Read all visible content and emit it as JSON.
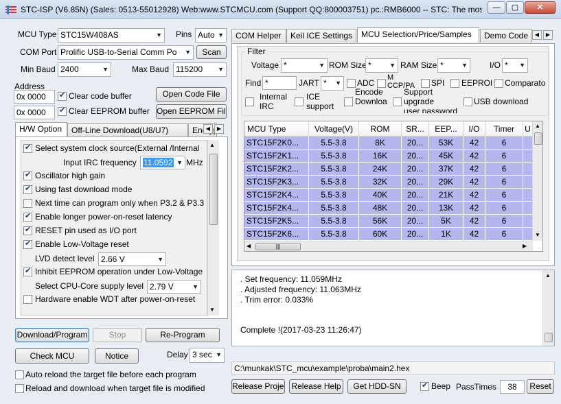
{
  "window": {
    "title": "STC-ISP (V6.85N) (Sales: 0513-55012928) Web:www.STCMCU.com  (Support QQ:800003751)  pc.:RMB6000 -- STC: The most p",
    "minimize_label": "—",
    "maximize_label": "▢",
    "close_label": "✕"
  },
  "left": {
    "mcu_type_label": "MCU Type",
    "mcu_type_value": "STC15W408AS",
    "pins_label": "Pins",
    "pins_value": "Auto",
    "com_port_label": "COM Port",
    "com_port_value": "Prolific USB-to-Serial Comm Po",
    "scan_label": "Scan",
    "min_baud_label": "Min Baud",
    "min_baud_value": "2400",
    "max_baud_label": "Max Baud",
    "max_baud_value": "115200",
    "address_label": "Address",
    "address1_value": "0x 0000",
    "address2_value": "0x 0000",
    "clear_code_label": "Clear code buffer",
    "clear_eeprom_label": "Clear EEPROM buffer",
    "open_code_label": "Open Code File",
    "open_eeprom_label": "Open EEPROM File"
  },
  "options_tabs": [
    "H/W Option",
    "Off-Line Download(U8/U7)",
    "Encryp"
  ],
  "hw_options": {
    "items": [
      {
        "label": "Select system clock source(External /Internal",
        "checked": true
      },
      {
        "label": "Oscillator high gain",
        "checked": true
      },
      {
        "label": "Using fast download mode",
        "checked": true
      },
      {
        "label": "Next time can program only when P3.2 & P3.3",
        "checked": false
      },
      {
        "label": "Enable longer power-on-reset latency",
        "checked": true
      },
      {
        "label": "RESET pin used as I/O port",
        "checked": true
      },
      {
        "label": "Enable Low-Voltage reset",
        "checked": true
      },
      {
        "label": "Inhibit EEPROM operation under Low-Voltage",
        "checked": true
      },
      {
        "label": "Hardware enable WDT after power-on-reset",
        "checked": false
      }
    ],
    "irc_label": "Input IRC frequency",
    "irc_value": "11.0592",
    "irc_unit": "MHz",
    "lvd_label": "LVD detect level",
    "lvd_value": "2.66 V",
    "cpu_core_label": "Select CPU-Core supply level",
    "cpu_core_value": "2.79 V"
  },
  "actions": {
    "download_label": "Download/Program",
    "stop_label": "Stop",
    "reprogram_label": "Re-Program",
    "check_mcu_label": "Check MCU",
    "notice_label": "Notice",
    "delay_label": "Delay",
    "delay_value": "3 sec",
    "auto_reload_label": "Auto reload the target file before each program",
    "reload_download_label": "Reload and download when target file is modified"
  },
  "right_tabs": [
    "COM Helper",
    "Keil ICE Settings",
    "MCU Selection/Price/Samples",
    "Demo Code"
  ],
  "filter": {
    "title": "Filter",
    "voltage_label": "Voltage",
    "voltage_value": "*",
    "rom_label": "ROM Size",
    "rom_value": "*",
    "ram_label": "RAM Size",
    "ram_value": "*",
    "io_label": "I/O",
    "io_value": "*",
    "find_label": "Find",
    "find_value": "*",
    "uart_label": "JART",
    "uart_value": "*",
    "adc_label": "ADC",
    "ccp_label": "M\nCCP/PA",
    "spi_label": "SPI",
    "eeprom_label": "EEPROI",
    "comparator_label": "Comparato",
    "internal_irc_label": "Internal\nIRC",
    "ice_support_label": "ICE\nsupport",
    "encode_label": "Encode\nDownloa",
    "support_upgrade_label": "Support\nupgrade\nuser password",
    "usb_download_label": "USB download"
  },
  "table": {
    "headers": [
      "MCU Type",
      "Voltage(V)",
      "ROM",
      "SR...",
      "EEP...",
      "I/O",
      "Timer",
      "U"
    ],
    "rows": [
      [
        "STC15F2K0...",
        "5.5-3.8",
        "8K",
        "20...",
        "53K",
        "42",
        "6"
      ],
      [
        "STC15F2K1...",
        "5.5-3.8",
        "16K",
        "20...",
        "45K",
        "42",
        "6"
      ],
      [
        "STC15F2K2...",
        "5.5-3.8",
        "24K",
        "20...",
        "37K",
        "42",
        "6"
      ],
      [
        "STC15F2K3...",
        "5.5-3.8",
        "32K",
        "20...",
        "29K",
        "42",
        "6"
      ],
      [
        "STC15F2K4...",
        "5.5-3.8",
        "40K",
        "20...",
        "21K",
        "42",
        "6"
      ],
      [
        "STC15F2K4...",
        "5.5-3.8",
        "48K",
        "20...",
        "13K",
        "42",
        "6"
      ],
      [
        "STC15F2K5...",
        "5.5-3.8",
        "56K",
        "20...",
        "5K",
        "42",
        "6"
      ],
      [
        "STC15F2K6...",
        "5.5-3.8",
        "60K",
        "20...",
        "1K",
        "42",
        "6"
      ]
    ],
    "hscroll_grip": "|||"
  },
  "log": {
    "lines": [
      ". Set frequency: 11.059MHz",
      ". Adjusted frequency: 11.063MHz",
      ". Trim error: 0.033%"
    ],
    "complete": "Complete !(2017-03-23 11:26:47)"
  },
  "bottom": {
    "file_path": "C:\\munkak\\STC_mcu\\example\\proba\\main2.hex",
    "release_project_label": "Release Project",
    "release_help_label": "Release Help",
    "get_hdd_label": "Get HDD-SN",
    "beep_label": "Beep",
    "pass_times_label": "PassTimes",
    "pass_times_value": "38",
    "reset_label": "Reset"
  },
  "colors": {
    "row_highlight": "#b3b7ed",
    "titlebar": "#c6d6ea",
    "close_button": "#c44b32"
  }
}
